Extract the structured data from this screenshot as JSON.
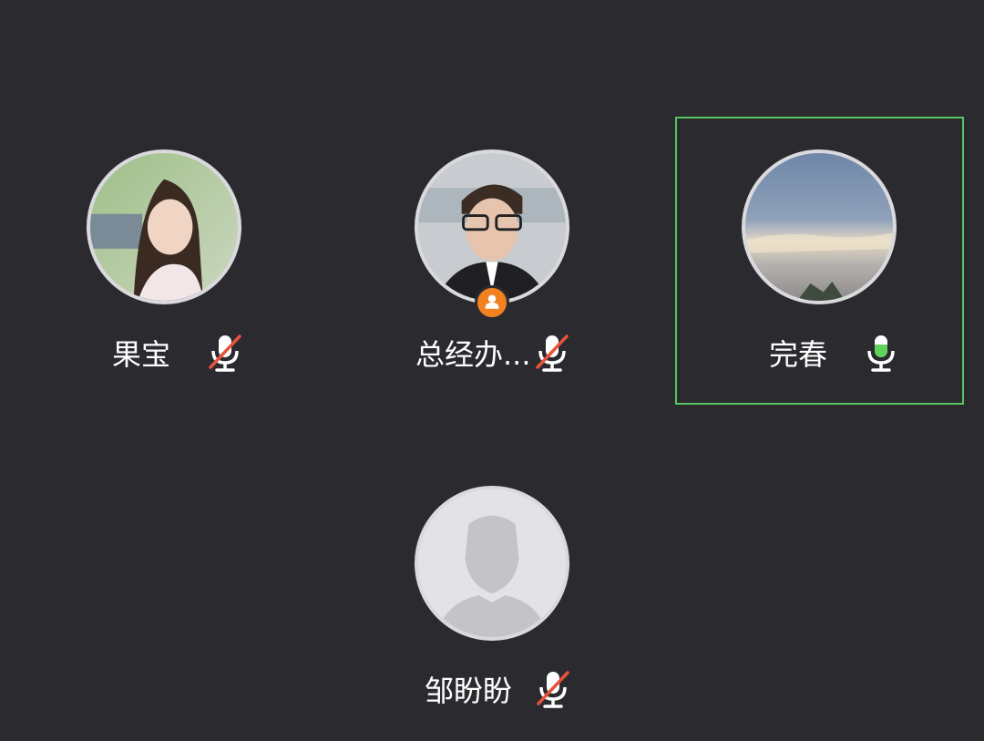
{
  "accent_color": "#55c463",
  "mute_color": "#e8523a",
  "host_badge_color": "#f2811f",
  "participants": [
    {
      "name": "果宝",
      "mic": "mic-muted-icon",
      "speaking": false,
      "host": false
    },
    {
      "name": "总经办...",
      "mic": "mic-muted-icon",
      "speaking": false,
      "host": true,
      "badge_icon": "user-icon"
    },
    {
      "name": "完春",
      "mic": "mic-active-icon",
      "speaking": true,
      "host": false
    },
    {
      "name": "邹盼盼",
      "mic": "mic-muted-icon",
      "speaking": false,
      "host": false,
      "avatar": "default-user-icon"
    }
  ]
}
